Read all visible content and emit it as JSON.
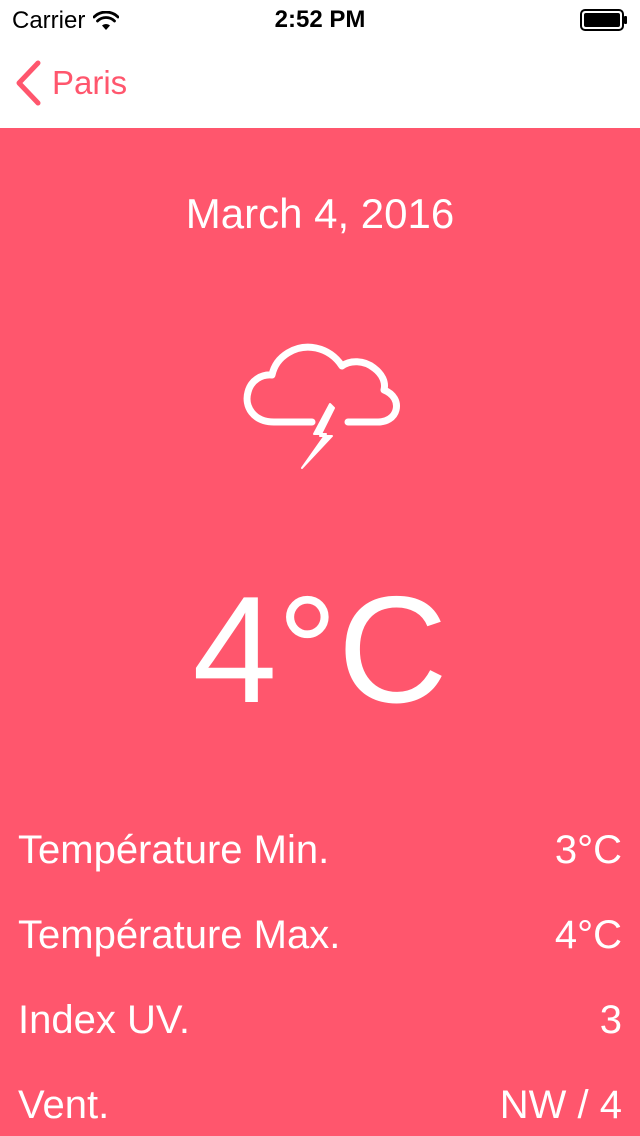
{
  "status_bar": {
    "carrier": "Carrier",
    "time": "2:52 PM"
  },
  "nav": {
    "back_label": "Paris"
  },
  "weather": {
    "date": "March 4, 2016",
    "condition_icon": "thunderstorm-cloud-icon",
    "temperature": "4°C"
  },
  "details": [
    {
      "label": "Température Min.",
      "value": "3°C"
    },
    {
      "label": "Température Max.",
      "value": "4°C"
    },
    {
      "label": "Index UV.",
      "value": "3"
    },
    {
      "label": "Vent.",
      "value": "NW / 4"
    }
  ],
  "colors": {
    "accent": "#ff566d",
    "text_on_accent": "#ffffff"
  }
}
